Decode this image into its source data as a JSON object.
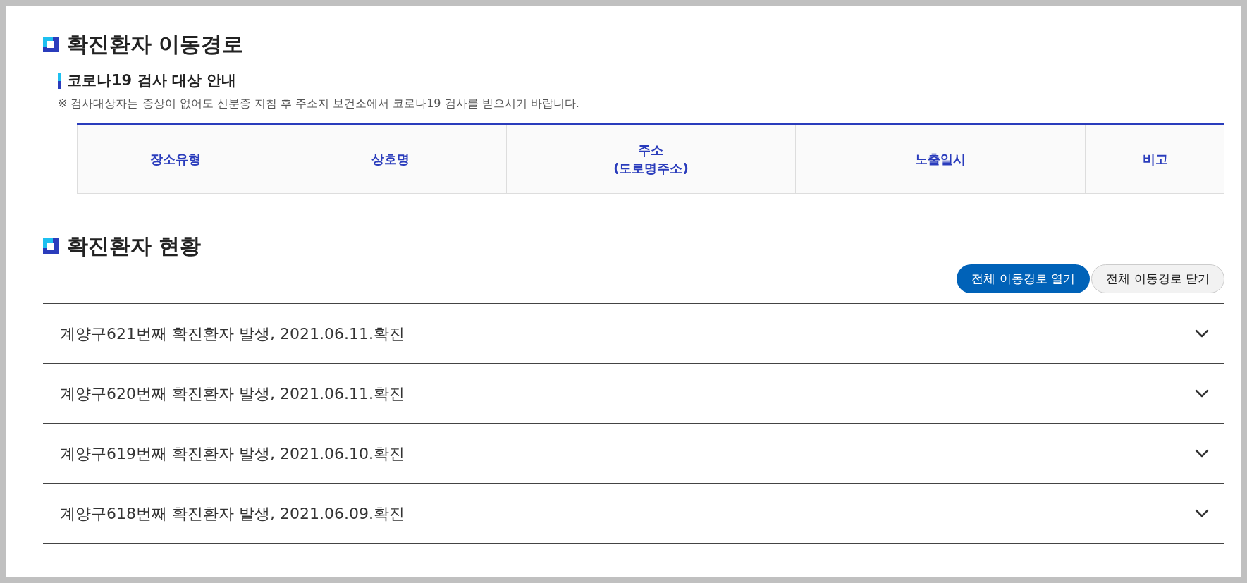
{
  "route_section": {
    "title": "확진환자 이동경로",
    "notice": {
      "heading": "코로나19 검사 대상 안내",
      "text": "※ 검사대상자는 증상이 없어도 신분증 지참 후 주소지 보건소에서 코로나19 검사를 받으시기 바랍니다."
    },
    "table": {
      "columns": [
        {
          "lines": [
            "장소유형"
          ]
        },
        {
          "lines": [
            "상호명"
          ]
        },
        {
          "lines": [
            "주소",
            "(도로명주소)"
          ]
        },
        {
          "lines": [
            "노출일시"
          ]
        },
        {
          "lines": [
            "비고"
          ]
        }
      ]
    }
  },
  "status_section": {
    "title": "확진환자 현황",
    "buttons": [
      {
        "label": "전체 이동경로 열기",
        "kind": "primary"
      },
      {
        "label": "전체 이동경로 닫기",
        "kind": "secondary"
      }
    ],
    "items": [
      {
        "label": "계양구621번째 확진환자 발생, 2021.06.11.확진",
        "expanded": false
      },
      {
        "label": "계양구620번째 확진환자 발생, 2021.06.11.확진",
        "expanded": false
      },
      {
        "label": "계양구619번째 확진환자 발생, 2021.06.10.확진",
        "expanded": false
      },
      {
        "label": "계양구618번째 확진환자 발생, 2021.06.09.확진",
        "expanded": false
      }
    ]
  }
}
